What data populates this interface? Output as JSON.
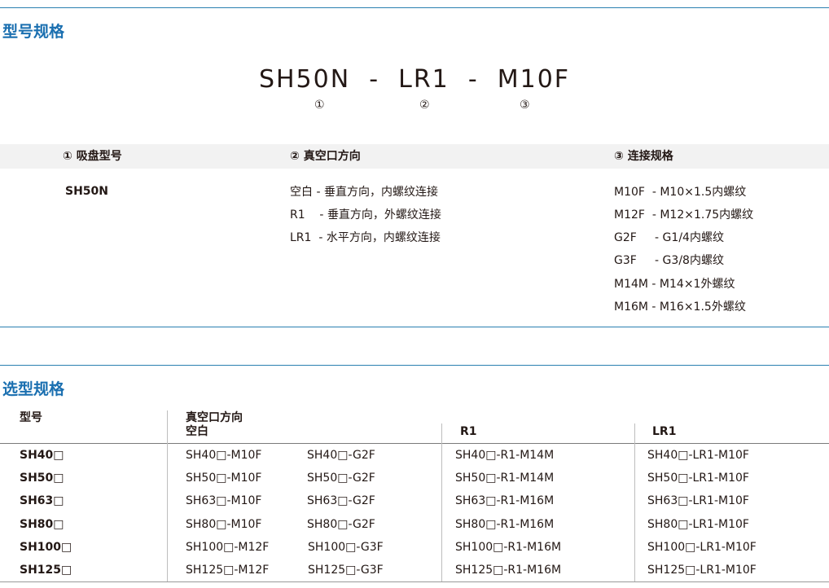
{
  "section1": {
    "title": "型号规格",
    "model_code": "SH50N  -  LR1  -  M10F",
    "markers": [
      "①",
      "②",
      "③"
    ],
    "headers": [
      "① 吸盘型号",
      "② 真空口方向",
      "③ 连接规格"
    ],
    "col1_values": [
      "SH50N"
    ],
    "col2_values": [
      "空白 - 垂直方向，内螺纹连接",
      "R1    - 垂直方向，外螺纹连接",
      "LR1  - 水平方向，内螺纹连接"
    ],
    "col3_values": [
      "M10F  - M10×1.5内螺纹",
      "M12F  - M12×1.75内螺纹",
      "G2F     - G1/4内螺纹",
      "G3F     - G3/8内螺纹",
      "M14M - M14×1外螺纹",
      "M16M - M16×1.5外螺纹"
    ]
  },
  "section2": {
    "title": "选型规格",
    "headers": {
      "model": "型号",
      "direction": "真空口方向",
      "blank": "空白",
      "r1": "R1",
      "lr1": "LR1"
    },
    "rows": [
      {
        "model": "SH40□",
        "blank_a": "SH40□-M10F",
        "blank_b": "SH40□-G2F",
        "r1": "SH40□-R1-M14M",
        "lr1": "SH40□-LR1-M10F"
      },
      {
        "model": "SH50□",
        "blank_a": "SH50□-M10F",
        "blank_b": "SH50□-G2F",
        "r1": "SH50□-R1-M14M",
        "lr1": "SH50□-LR1-M10F"
      },
      {
        "model": "SH63□",
        "blank_a": "SH63□-M10F",
        "blank_b": "SH63□-G2F",
        "r1": "SH63□-R1-M16M",
        "lr1": "SH63□-LR1-M10F"
      },
      {
        "model": "SH80□",
        "blank_a": "SH80□-M10F",
        "blank_b": "SH80□-G2F",
        "r1": "SH80□-R1-M16M",
        "lr1": "SH80□-LR1-M10F"
      },
      {
        "model": "SH100□",
        "blank_a": "SH100□-M12F",
        "blank_b": "SH100□-G3F",
        "r1": "SH100□-R1-M16M",
        "lr1": "SH100□-LR1-M10F"
      },
      {
        "model": "SH125□",
        "blank_a": "SH125□-M12F",
        "blank_b": "SH125□-G3F",
        "r1": "SH125□-R1-M16M",
        "lr1": "SH125□-LR1-M10F"
      }
    ]
  },
  "colors": {
    "accent": "#1a6fb0",
    "rule": "#2a7fb0",
    "header_band": "#f2f2f2",
    "text": "#231815"
  }
}
